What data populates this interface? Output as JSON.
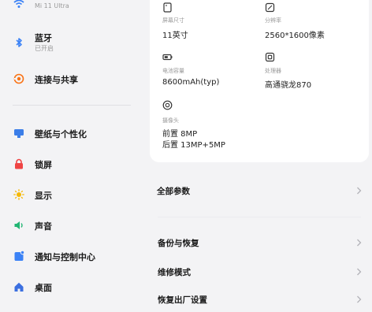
{
  "sidebar": {
    "device_model": "Mi 11 Ultra",
    "items": [
      {
        "label": "蓝牙",
        "sub": "已开启",
        "icon": "bluetooth-icon",
        "color": "#3b82f6"
      },
      {
        "label": "连接与共享",
        "icon": "share-icon",
        "color": "#f97316"
      },
      {
        "label": "壁纸与个性化",
        "icon": "wallpaper-icon",
        "color": "#3b7ee8"
      },
      {
        "label": "锁屏",
        "icon": "lock-icon",
        "color": "#ef4444"
      },
      {
        "label": "显示",
        "icon": "display-icon",
        "color": "#f5b700"
      },
      {
        "label": "声音",
        "icon": "sound-icon",
        "color": "#22b573"
      },
      {
        "label": "通知与控制中心",
        "icon": "notification-icon",
        "color": "#3b82f6"
      },
      {
        "label": "桌面",
        "icon": "home-icon",
        "color": "#3b6fe0"
      }
    ]
  },
  "specs": [
    {
      "label": "屏幕尺寸",
      "value": "11英寸",
      "icon": "screen-size-icon"
    },
    {
      "label": "分辨率",
      "value": "2560*1600像素",
      "icon": "resolution-icon"
    },
    {
      "label": "电池容量",
      "value": "8600mAh(typ)",
      "icon": "battery-icon"
    },
    {
      "label": "处理器",
      "value": "高通骁龙870",
      "icon": "processor-icon"
    },
    {
      "label": "摄像头",
      "value_line1": "前置 8MP",
      "value_line2": "后置 13MP+5MP",
      "icon": "camera-icon"
    }
  ],
  "rows": {
    "all_params": "全部参数",
    "backup": "备份与恢复",
    "repair": "维修模式",
    "factory_reset_partial": "恢复出厂设置"
  }
}
